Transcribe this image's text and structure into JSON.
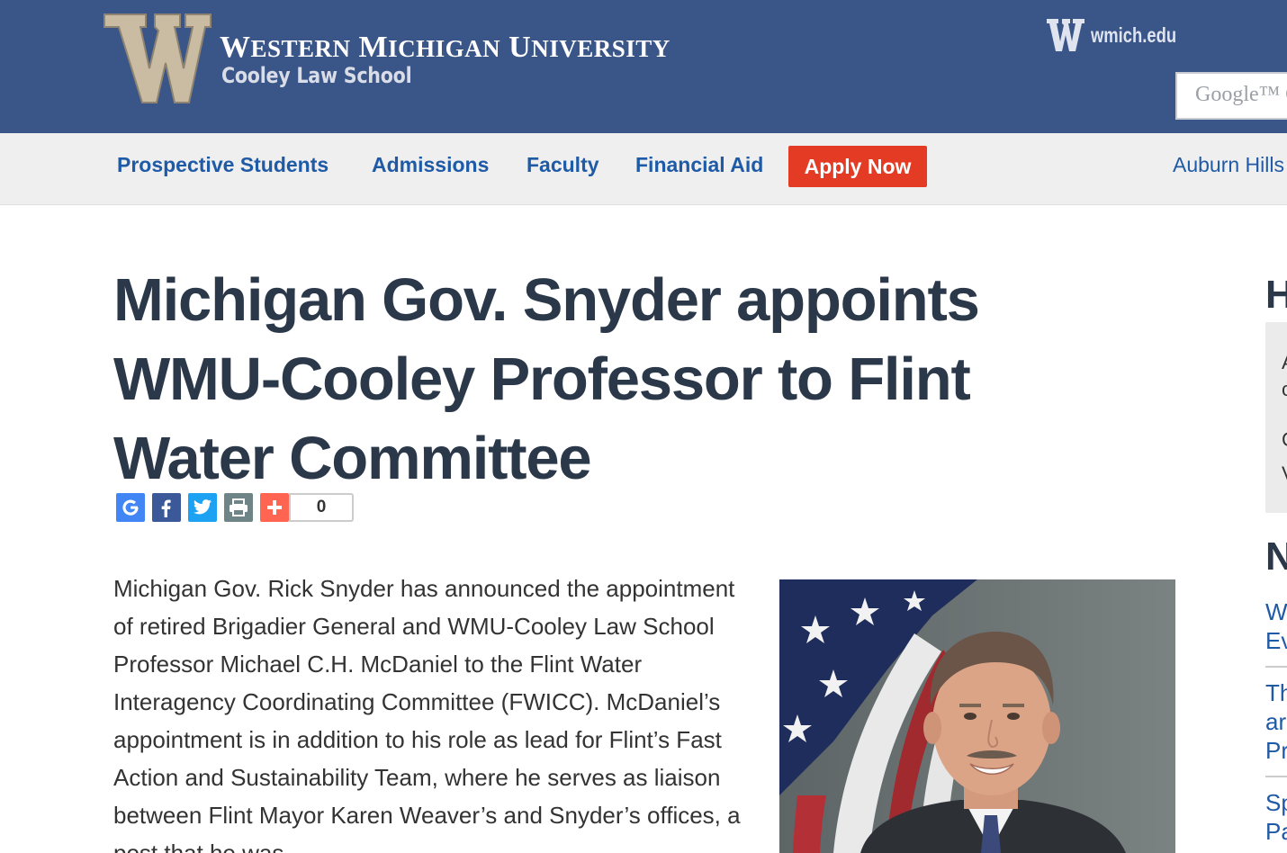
{
  "header": {
    "university_name_first": "W",
    "university_name_rest": "ESTERN",
    "university_m": "M",
    "university_ichigan": "ICHIGAN",
    "university_u": "U",
    "university_niversity": "NIVERSITY",
    "school_name": "Cooley Law School",
    "wmich_link": "wmich.edu",
    "search_placeholder": "Google™ C"
  },
  "nav": {
    "items": [
      {
        "label": "Prospective Students"
      },
      {
        "label": "Admissions"
      },
      {
        "label": "Faculty"
      },
      {
        "label": "Financial Aid"
      }
    ],
    "apply_label": "Apply Now",
    "location_label": "Auburn Hills"
  },
  "article": {
    "title": "Michigan Gov. Snyder appoints WMU-Cooley Professor to Flint Water Committee",
    "share_count": "0",
    "body": "Michigan Gov. Rick Snyder has announced the appointment of retired Brigadier General and WMU-Cooley Law School Professor Michael C.H. McDaniel to the Flint Water Interagency Coordinating Committee (FWICC). McDaniel’s appointment is in addition to his role as lead for Flint’s Fast Action and Sustainability Team, where he serves as liaison between Flint Mayor Karen Weaver’s and Snyder’s offices, a post that he was"
  },
  "sidebar": {
    "heading_1": "H",
    "box_lines": [
      "A",
      "c",
      "C",
      "V"
    ],
    "heading_2": "N",
    "news_fragments": [
      [
        "W",
        "Ev"
      ],
      [
        "Th",
        "ar",
        "Pr"
      ],
      [
        "Sp",
        "Pa"
      ]
    ]
  },
  "colors": {
    "header_bg": "#3a5588",
    "nav_bg": "#efefef",
    "link": "#1f5aa6",
    "apply_bg": "#e43b25",
    "title": "#2b3849"
  },
  "icons": [
    "wmu-w-logo",
    "google-share-icon",
    "facebook-share-icon",
    "twitter-share-icon",
    "print-icon",
    "add-share-icon"
  ]
}
